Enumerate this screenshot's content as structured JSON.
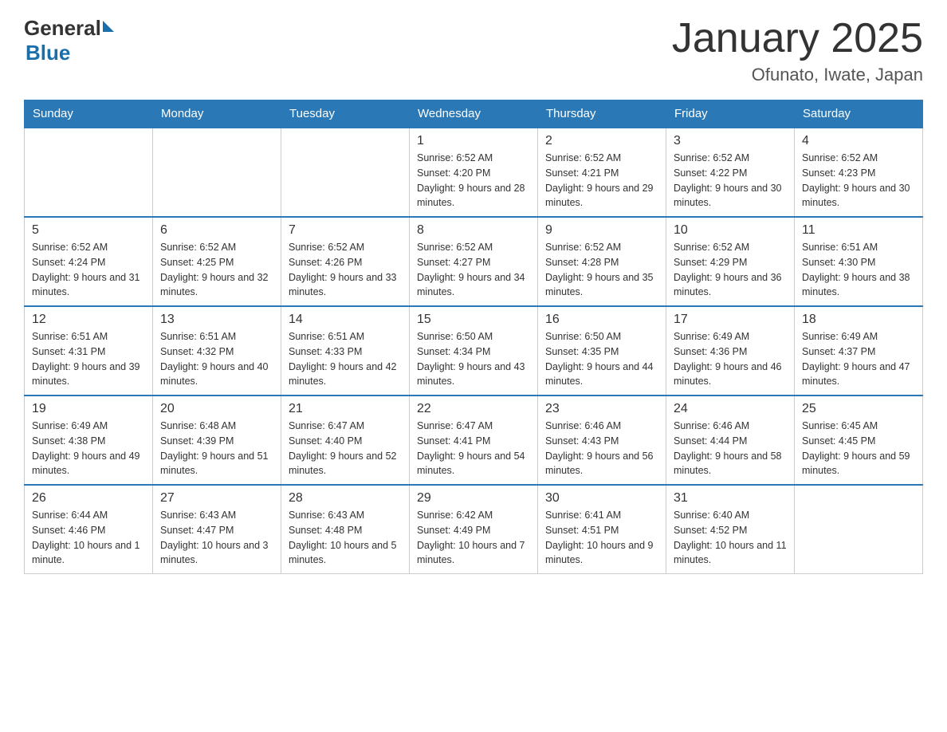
{
  "logo": {
    "text_general": "General",
    "triangle": "▲",
    "text_blue": "Blue"
  },
  "title": "January 2025",
  "subtitle": "Ofunato, Iwate, Japan",
  "weekdays": [
    "Sunday",
    "Monday",
    "Tuesday",
    "Wednesday",
    "Thursday",
    "Friday",
    "Saturday"
  ],
  "weeks": [
    [
      {
        "day": "",
        "info": ""
      },
      {
        "day": "",
        "info": ""
      },
      {
        "day": "",
        "info": ""
      },
      {
        "day": "1",
        "info": "Sunrise: 6:52 AM\nSunset: 4:20 PM\nDaylight: 9 hours and 28 minutes."
      },
      {
        "day": "2",
        "info": "Sunrise: 6:52 AM\nSunset: 4:21 PM\nDaylight: 9 hours and 29 minutes."
      },
      {
        "day": "3",
        "info": "Sunrise: 6:52 AM\nSunset: 4:22 PM\nDaylight: 9 hours and 30 minutes."
      },
      {
        "day": "4",
        "info": "Sunrise: 6:52 AM\nSunset: 4:23 PM\nDaylight: 9 hours and 30 minutes."
      }
    ],
    [
      {
        "day": "5",
        "info": "Sunrise: 6:52 AM\nSunset: 4:24 PM\nDaylight: 9 hours and 31 minutes."
      },
      {
        "day": "6",
        "info": "Sunrise: 6:52 AM\nSunset: 4:25 PM\nDaylight: 9 hours and 32 minutes."
      },
      {
        "day": "7",
        "info": "Sunrise: 6:52 AM\nSunset: 4:26 PM\nDaylight: 9 hours and 33 minutes."
      },
      {
        "day": "8",
        "info": "Sunrise: 6:52 AM\nSunset: 4:27 PM\nDaylight: 9 hours and 34 minutes."
      },
      {
        "day": "9",
        "info": "Sunrise: 6:52 AM\nSunset: 4:28 PM\nDaylight: 9 hours and 35 minutes."
      },
      {
        "day": "10",
        "info": "Sunrise: 6:52 AM\nSunset: 4:29 PM\nDaylight: 9 hours and 36 minutes."
      },
      {
        "day": "11",
        "info": "Sunrise: 6:51 AM\nSunset: 4:30 PM\nDaylight: 9 hours and 38 minutes."
      }
    ],
    [
      {
        "day": "12",
        "info": "Sunrise: 6:51 AM\nSunset: 4:31 PM\nDaylight: 9 hours and 39 minutes."
      },
      {
        "day": "13",
        "info": "Sunrise: 6:51 AM\nSunset: 4:32 PM\nDaylight: 9 hours and 40 minutes."
      },
      {
        "day": "14",
        "info": "Sunrise: 6:51 AM\nSunset: 4:33 PM\nDaylight: 9 hours and 42 minutes."
      },
      {
        "day": "15",
        "info": "Sunrise: 6:50 AM\nSunset: 4:34 PM\nDaylight: 9 hours and 43 minutes."
      },
      {
        "day": "16",
        "info": "Sunrise: 6:50 AM\nSunset: 4:35 PM\nDaylight: 9 hours and 44 minutes."
      },
      {
        "day": "17",
        "info": "Sunrise: 6:49 AM\nSunset: 4:36 PM\nDaylight: 9 hours and 46 minutes."
      },
      {
        "day": "18",
        "info": "Sunrise: 6:49 AM\nSunset: 4:37 PM\nDaylight: 9 hours and 47 minutes."
      }
    ],
    [
      {
        "day": "19",
        "info": "Sunrise: 6:49 AM\nSunset: 4:38 PM\nDaylight: 9 hours and 49 minutes."
      },
      {
        "day": "20",
        "info": "Sunrise: 6:48 AM\nSunset: 4:39 PM\nDaylight: 9 hours and 51 minutes."
      },
      {
        "day": "21",
        "info": "Sunrise: 6:47 AM\nSunset: 4:40 PM\nDaylight: 9 hours and 52 minutes."
      },
      {
        "day": "22",
        "info": "Sunrise: 6:47 AM\nSunset: 4:41 PM\nDaylight: 9 hours and 54 minutes."
      },
      {
        "day": "23",
        "info": "Sunrise: 6:46 AM\nSunset: 4:43 PM\nDaylight: 9 hours and 56 minutes."
      },
      {
        "day": "24",
        "info": "Sunrise: 6:46 AM\nSunset: 4:44 PM\nDaylight: 9 hours and 58 minutes."
      },
      {
        "day": "25",
        "info": "Sunrise: 6:45 AM\nSunset: 4:45 PM\nDaylight: 9 hours and 59 minutes."
      }
    ],
    [
      {
        "day": "26",
        "info": "Sunrise: 6:44 AM\nSunset: 4:46 PM\nDaylight: 10 hours and 1 minute."
      },
      {
        "day": "27",
        "info": "Sunrise: 6:43 AM\nSunset: 4:47 PM\nDaylight: 10 hours and 3 minutes."
      },
      {
        "day": "28",
        "info": "Sunrise: 6:43 AM\nSunset: 4:48 PM\nDaylight: 10 hours and 5 minutes."
      },
      {
        "day": "29",
        "info": "Sunrise: 6:42 AM\nSunset: 4:49 PM\nDaylight: 10 hours and 7 minutes."
      },
      {
        "day": "30",
        "info": "Sunrise: 6:41 AM\nSunset: 4:51 PM\nDaylight: 10 hours and 9 minutes."
      },
      {
        "day": "31",
        "info": "Sunrise: 6:40 AM\nSunset: 4:52 PM\nDaylight: 10 hours and 11 minutes."
      },
      {
        "day": "",
        "info": ""
      }
    ]
  ]
}
